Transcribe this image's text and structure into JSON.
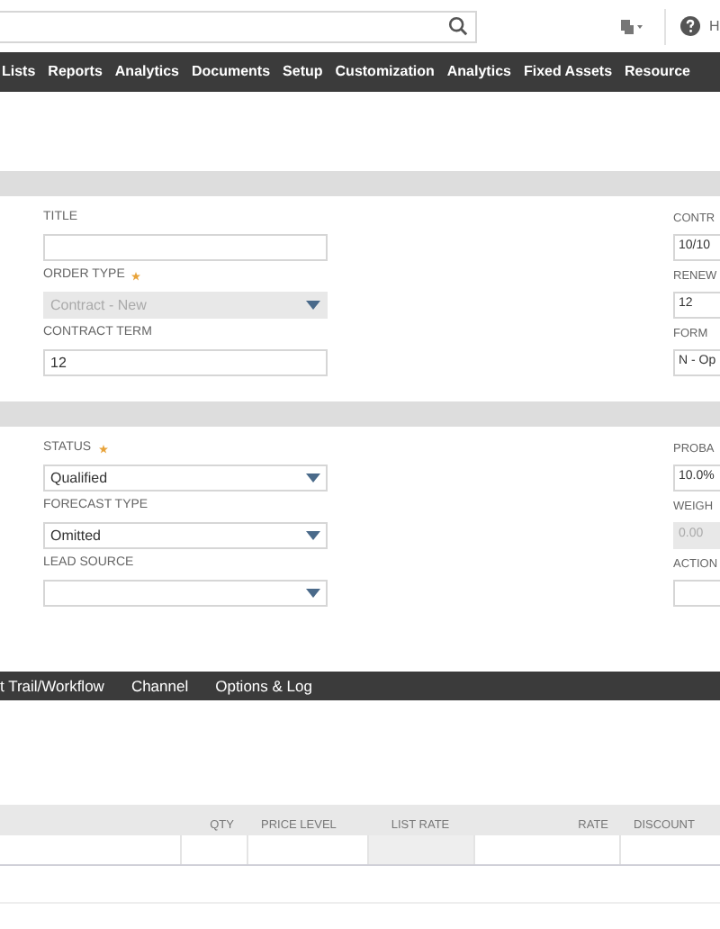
{
  "header": {
    "help_label": "H"
  },
  "nav": [
    "Lists",
    "Reports",
    "Analytics",
    "Documents",
    "Setup",
    "Customization",
    "Analytics",
    "Fixed Assets",
    "Resource"
  ],
  "sections": [
    {
      "left": [
        {
          "label": "TITLE",
          "kind": "text",
          "required": false,
          "disabled": false
        },
        {
          "label": "ORDER TYPE",
          "kind": "select",
          "value": "Contract - New",
          "required": true,
          "disabled": true
        },
        {
          "label": "CONTRACT TERM",
          "kind": "text",
          "value": "12",
          "required": false,
          "disabled": false
        }
      ],
      "right": [
        {
          "label": "CONTR",
          "value": "10/10",
          "disabled": false
        },
        {
          "label": "RENEW",
          "value": "12",
          "disabled": false
        },
        {
          "label": "FORM",
          "value": "N - Op",
          "disabled": false
        }
      ]
    },
    {
      "left": [
        {
          "label": "STATUS",
          "kind": "select",
          "value": "Qualified",
          "required": true,
          "disabled": false
        },
        {
          "label": "FORECAST TYPE",
          "kind": "select",
          "value": "Omitted",
          "required": false,
          "disabled": false
        },
        {
          "label": "LEAD SOURCE",
          "kind": "select",
          "required": false,
          "disabled": false
        }
      ],
      "right": [
        {
          "label": "PROBA",
          "value": "10.0%",
          "disabled": false
        },
        {
          "label": "WEIGH",
          "value": "0.00",
          "disabled": true
        },
        {
          "label": "ACTION",
          "disabled": false
        }
      ]
    }
  ],
  "tabs": [
    "t Trail/Workflow",
    "Channel",
    "Options & Log"
  ],
  "table": {
    "columns": [
      "",
      "QTY",
      "PRICE LEVEL",
      "LIST RATE",
      "RATE",
      "DISCOUNT"
    ]
  }
}
